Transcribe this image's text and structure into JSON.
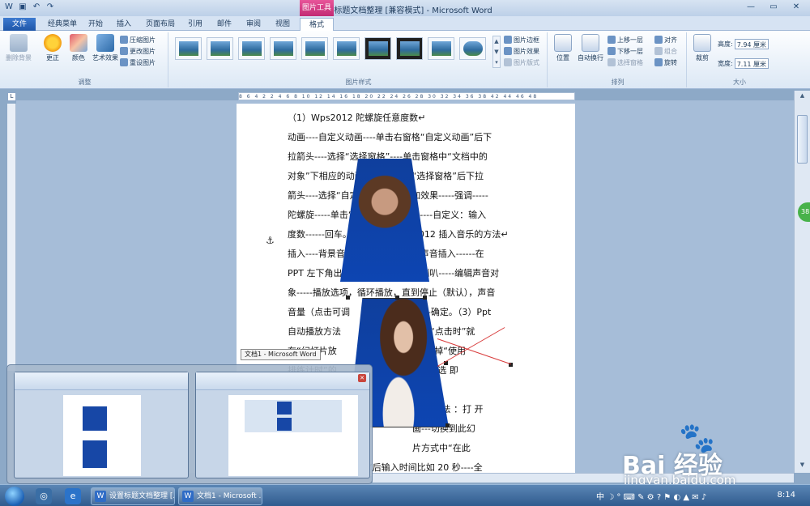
{
  "window": {
    "title": "设置标题文档整理 [兼容模式] - Microsoft Word",
    "context_tab": "图片工具"
  },
  "tabs": [
    "文件",
    "经典菜单",
    "开始",
    "插入",
    "页面布局",
    "引用",
    "邮件",
    "审阅",
    "视图",
    "格式"
  ],
  "ribbon": {
    "adjust": {
      "label": "调整",
      "remove_bg": "删除背景",
      "correct": "更正",
      "color": "颜色",
      "art": "艺术效果",
      "compress": "压缩图片",
      "change": "更改图片",
      "reset": "重设图片"
    },
    "styles": {
      "label": "图片样式",
      "border": "图片边框",
      "effects": "图片效果",
      "layout": "图片版式"
    },
    "arrange": {
      "label": "排列",
      "position": "位置",
      "wrap": "自动换行",
      "forward": "上移一层",
      "backward": "下移一层",
      "pane": "选择窗格",
      "align": "对齐",
      "group": "组合",
      "rotate": "旋转"
    },
    "size": {
      "label": "大小",
      "crop": "裁剪",
      "height_label": "高度:",
      "height_value": "7.94 厘米",
      "width_label": "宽度:",
      "width_value": "7.11 厘米"
    }
  },
  "ruler": {
    "corner": "L",
    "marks": "8 6 4 2 2 4 6 8 10 12 14 16 18 20 22 24 26 28 30 32 34 36 38 42 44 46 48"
  },
  "document": {
    "lines": [
      "（1）Wps2012 陀螺旋任意度数↵",
      "动画----自定义动画----单击右窗格“自定义动画”后下",
      "拉箭头----选择“选择窗格”----单击窗格中“文档中的",
      "对象”下相应的动画对象----单击“选择窗格”后下拉",
      "箭头----选择“自定义动画”----添加效果-----强调-----",
      "陀螺旋-----单击“数量”后下拉箭头----自定义：输入",
      "度数------回车。（2）Wps 演示 2012 插入音乐的方法↵",
      "插入----背景音乐----选择文件中的声音插入------在",
      "PPT 左下角出现小喇叭-----右击小喇叭-----编辑声音对",
      "象-----播放选项，循环播放，直到停止（默认），声音",
      "音量（点击可调　　　　　　整）---确定。（3）Ppt",
      "自动播放方法　　　　　　　若想用“点击时”就",
      "在“幻灯片放　　　　　　　映”----去掉“使用",
      "排练计时”的　　　　　　　　　　勾 选 即",
      "　",
      "　　　　　　　　　　　　　　　　方 法 ：打 开",
      "　　　　　　　　　　　　　　画---切换到此幻",
      "　　　　　　　　　　　　　　片方式中“在此",
      "　　　　　　　效果”后输入时间比如 20 秒----全"
    ]
  },
  "scroll": {
    "badge": "38"
  },
  "preview": {
    "tooltip": "文档1 - Microsoft Word"
  },
  "watermark": {
    "brand": "Bai 经验",
    "url": "jingyan.baidu.com"
  },
  "taskbar": {
    "item1": "设置标题文档整理 [...",
    "item2": "文档1 - Microsoft ...",
    "ime": "中",
    "time": "8:14"
  },
  "icons": {
    "save": "save-icon",
    "undo": "undo-icon",
    "redo": "redo-icon",
    "anchor": "anchor-icon",
    "start": "windows-start-icon"
  }
}
